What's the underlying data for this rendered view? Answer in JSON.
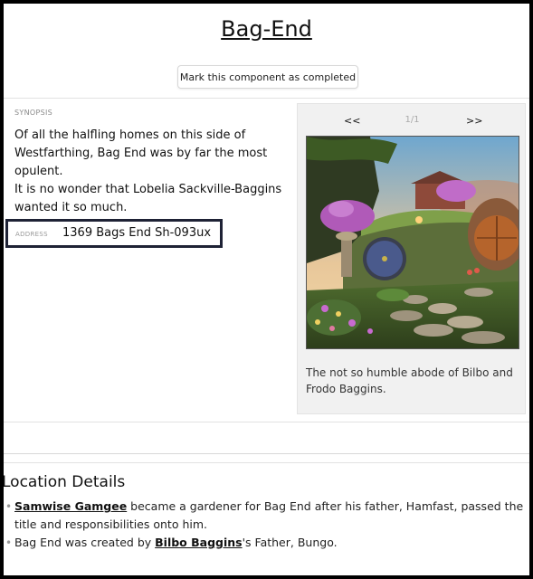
{
  "page": {
    "title": "Bag-End",
    "complete_button": "Mark this component as completed"
  },
  "synopsis": {
    "label": "Synopsis",
    "lines": [
      "Of all the halfling homes on this side of Westfarthing, Bag End was by far the most opulent.",
      "It is no wonder that Lobelia Sackville-Baggins wanted it so much."
    ]
  },
  "address": {
    "label": "Address",
    "value": "1369 Bags End Sh-093ux"
  },
  "gallery": {
    "prev": "<<",
    "counter": "1/1",
    "next": ">>",
    "caption": "The not so humble abode of Bilbo and Frodo Baggins."
  },
  "location": {
    "heading": "Location Details",
    "items": [
      {
        "link": "Samwise Gamgee",
        "text_after": " became a gardener for Bag End after his father, Hamfast, passed the title and responsibilities onto him."
      },
      {
        "text_before": "Bag End was created by ",
        "link": "Bilbo Baggins",
        "text_after": "'s Father, Bungo."
      }
    ]
  },
  "colors": {
    "frame": "#000000",
    "highlight_border": "#1e2235",
    "gallery_bg": "#f1f1f1",
    "door_blue": "#4a5a8c",
    "door_wood": "#b5642c",
    "flowers": "#b05ab8"
  }
}
